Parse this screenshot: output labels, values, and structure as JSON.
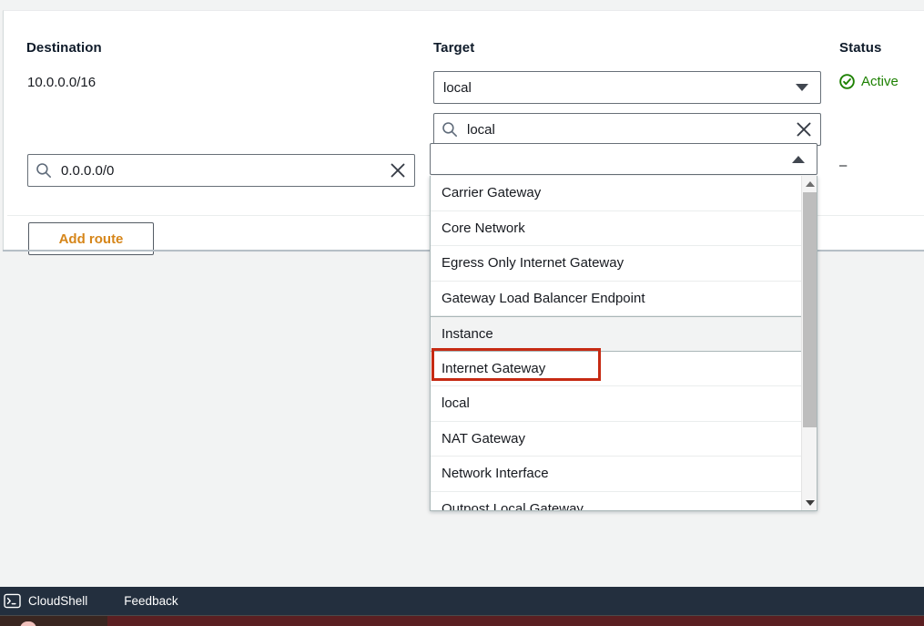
{
  "colors": {
    "page_background": "#f2f3f3",
    "card_background": "#ffffff",
    "accent_orange": "#d6861a",
    "status_active_green": "#1d8102",
    "annotation_red": "#c62a13",
    "console_navy": "#232f3e",
    "border_gray": "#687078"
  },
  "table": {
    "headers": {
      "destination": "Destination",
      "target": "Target",
      "status": "Status"
    },
    "rows": [
      {
        "destination": "10.0.0.0/16",
        "target_value": "local",
        "status": "Active",
        "status_icon": "check-circle-icon"
      },
      {
        "destination_value": "0.0.0.0/0",
        "destination_placeholder": "",
        "target_value": "",
        "status": "–"
      }
    ]
  },
  "target_filter": {
    "value": "local",
    "placeholder": "",
    "search_icon": "search-icon",
    "clear_icon": "close-x-icon"
  },
  "destination_input": {
    "value": "0.0.0.0/0",
    "placeholder": "",
    "search_icon": "search-icon",
    "clear_icon": "close-x-icon"
  },
  "target_dropdown": {
    "expanded": true,
    "caret_icon": "chevron-up-icon",
    "hovered_option": "Instance",
    "annotated_option": "Internet Gateway",
    "options": [
      "Carrier Gateway",
      "Core Network",
      "Egress Only Internet Gateway",
      "Gateway Load Balancer Endpoint",
      "Instance",
      "Internet Gateway",
      "local",
      "NAT Gateway",
      "Network Interface",
      "Outpost Local Gateway"
    ],
    "scrollbar": {
      "up_arrow_icon": "scroll-up-arrow-icon",
      "down_arrow_icon": "scroll-down-arrow-icon"
    }
  },
  "actions": {
    "add_route_label": "Add route"
  },
  "console_bar": {
    "cloudshell_icon": "cloudshell-terminal-icon",
    "cloudshell_label": "CloudShell",
    "feedback_label": "Feedback"
  }
}
